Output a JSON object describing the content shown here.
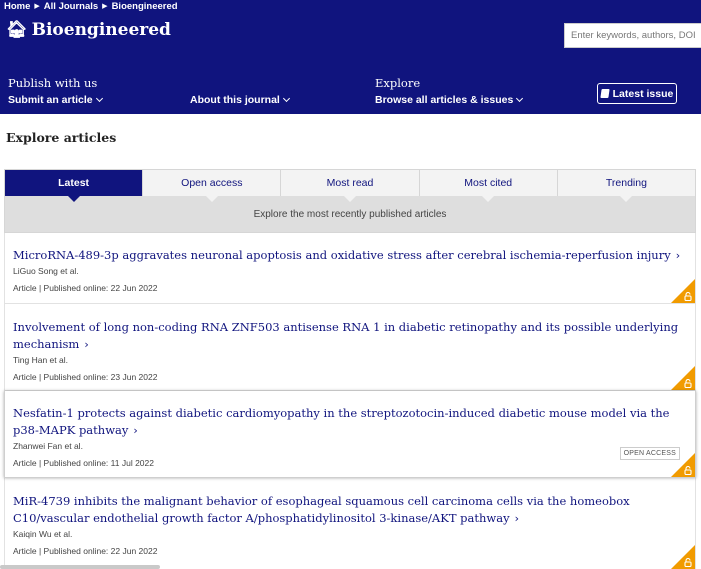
{
  "breadcrumb": [
    "Home",
    "All Journals",
    "Bioengineered"
  ],
  "journal": {
    "title": "Bioengineered",
    "icon": "home-icon"
  },
  "search": {
    "placeholder": "Enter keywords, authors, DOI, ORCID etc"
  },
  "nav": {
    "publish": {
      "heading": "Publish with us",
      "link": "Submit an article"
    },
    "about": {
      "link": "About this journal"
    },
    "explore": {
      "heading": "Explore",
      "link": "Browse all articles & issues"
    },
    "latest_issue": "Latest issue"
  },
  "explore_title": "Explore articles",
  "tabs": [
    {
      "label": "Latest",
      "active": true
    },
    {
      "label": "Open access",
      "active": false
    },
    {
      "label": "Most read",
      "active": false
    },
    {
      "label": "Most cited",
      "active": false
    },
    {
      "label": "Trending",
      "active": false
    }
  ],
  "tab_description": "Explore the most recently published articles",
  "articles": [
    {
      "title": "MicroRNA-489-3p aggravates neuronal apoptosis and oxidative stress after cerebral ischemia-reperfusion injury",
      "authors": "LiGuo Song et al.",
      "meta": "Article | Published online: 22 Jun 2022",
      "open_access_badge": ""
    },
    {
      "title": "Involvement of long non-coding RNA ZNF503 antisense RNA 1 in diabetic retinopathy and its possible underlying mechanism",
      "authors": "Ting Han et al.",
      "meta": "Article | Published online: 23 Jun 2022",
      "open_access_badge": ""
    },
    {
      "title": "Nesfatin-1 protects against diabetic cardiomyopathy in the streptozotocin-induced diabetic mouse model via the p38-MAPK pathway",
      "authors": "Zhanwei Fan et al.",
      "meta": "Article | Published online: 11 Jul 2022",
      "open_access_badge": "OPEN ACCESS"
    },
    {
      "title": "MiR-4739 inhibits the malignant behavior of esophageal squamous cell carcinoma cells via the homeobox C10/vascular endothelial growth factor A/phosphatidylinositol 3-kinase/AKT pathway",
      "authors": "Kaiqin Wu et al.",
      "meta": "Article | Published online: 22 Jun 2022",
      "open_access_badge": ""
    }
  ],
  "colors": {
    "brand": "#10147e",
    "open_access": "#f19b00",
    "tab_bar": "#f3f3f3",
    "tab_desc": "#dedede"
  }
}
